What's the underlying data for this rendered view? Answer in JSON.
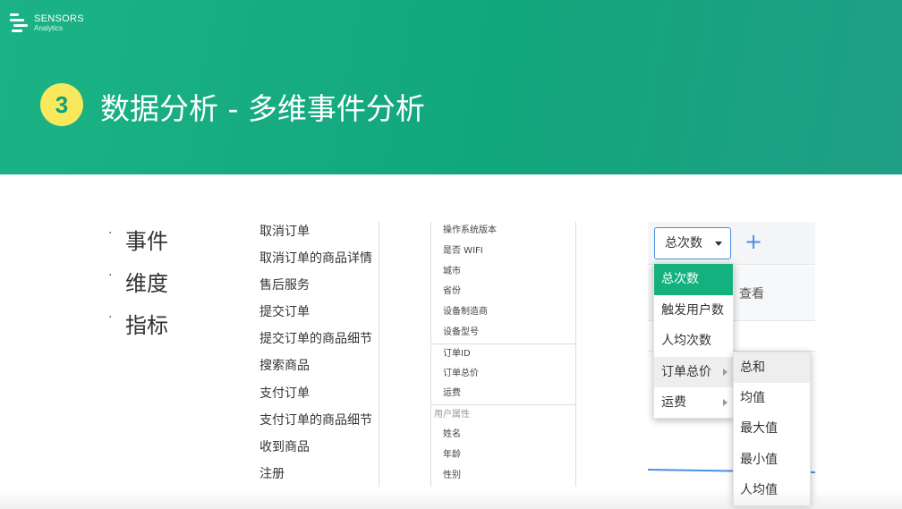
{
  "brand": {
    "name": "SENSORS",
    "sub": "Analytics"
  },
  "slide": {
    "step": "3",
    "title": "数据分析 - 多维事件分析"
  },
  "bullets": [
    "事件",
    "维度",
    "指标"
  ],
  "events": [
    "取消订单",
    "取消订单的商品详情",
    "售后服务",
    "提交订单",
    "提交订单的商品细节",
    "搜索商品",
    "支付订单",
    "支付订单的商品细节",
    "收到商品",
    "注册"
  ],
  "dimensions": {
    "system": [
      "操作系统版本",
      "是否 WIFI",
      "城市",
      "省份",
      "设备制造商",
      "设备型号"
    ],
    "event": [
      "订单ID",
      "订单总价",
      "运费"
    ],
    "user_group_label": "用户属性",
    "user": [
      "姓名",
      "年龄",
      "性别"
    ]
  },
  "metric_panel": {
    "selected": "总次数",
    "add_label": "+",
    "view_label": "查看",
    "options": [
      "总次数",
      "触发用户数",
      "人均次数",
      "订单总价",
      "运费"
    ],
    "submenu": [
      "总和",
      "均值",
      "最大值",
      "最小值",
      "人均值"
    ]
  },
  "colors": {
    "brand_green": "#13b17e",
    "badge_yellow": "#f7e85c",
    "link_blue": "#4a90e2"
  }
}
